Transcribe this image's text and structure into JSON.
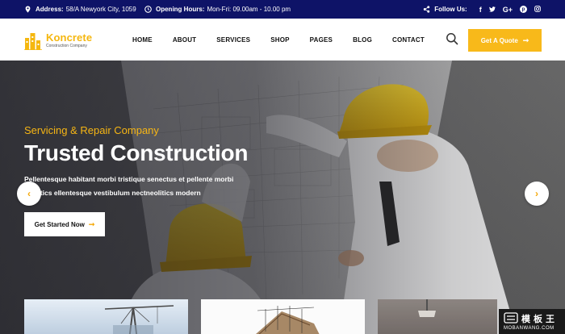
{
  "topbar": {
    "address_label": "Address:",
    "address_value": "58/A Newyork City, 1059",
    "hours_label": "Opening Hours:",
    "hours_value": "Mon-Fri: 09.00am - 10.00 pm",
    "follow_label": "Follow Us:",
    "social": [
      {
        "icon": "facebook-icon",
        "glyph": "f"
      },
      {
        "icon": "twitter-icon",
        "glyph": "t"
      },
      {
        "icon": "google-plus-icon",
        "glyph": "G+"
      },
      {
        "icon": "pinterest-icon",
        "glyph": "p"
      },
      {
        "icon": "instagram-icon",
        "glyph": "◎"
      }
    ]
  },
  "header": {
    "logo_name": "Koncrete",
    "logo_tagline": "Construction Company",
    "nav": [
      "HOME",
      "ABOUT",
      "SERVICES",
      "SHOP",
      "PAGES",
      "BLOG",
      "CONTACT"
    ],
    "quote_button": "Get A Quote",
    "search_icon": "search-icon"
  },
  "hero": {
    "kicker": "Servicing & Repair Company",
    "headline": "Trusted Construction",
    "description": "Pellentesque habitant morbi tristique senectus et pellente morbi neolitics ellentesque vestibulum nectneolitics modern",
    "cta_label": "Get Started Now",
    "prev_icon": "chevron-left-icon",
    "next_icon": "chevron-right-icon"
  },
  "colors": {
    "topbar_bg": "#0e1367",
    "accent": "#f8b91a",
    "text_dark": "#111111",
    "white": "#ffffff"
  },
  "watermark": {
    "title": "模板王",
    "subtitle": "MOBANWANG.COM"
  }
}
